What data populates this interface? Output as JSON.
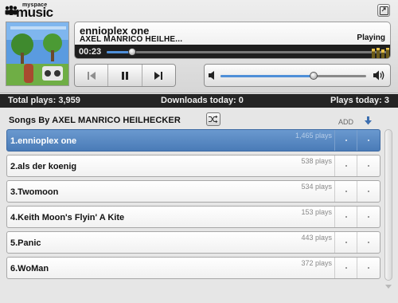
{
  "logo": {
    "small": "myspace",
    "big": "music"
  },
  "now_playing": {
    "title": "ennioplex one",
    "artist": "AXEL MANRICO HEILHE...",
    "status": "Playing",
    "elapsed": "00:23",
    "progress_fraction": 0.09,
    "volume_fraction": 0.64
  },
  "stats": {
    "total_plays": "Total plays: 3,959",
    "downloads_today": "Downloads today: 0",
    "plays_today": "Plays today: 3"
  },
  "songs": {
    "heading": "Songs By AXEL MANRICO HEILHECKER",
    "add_label": "ADD",
    "items": [
      {
        "name": "1.ennioplex one",
        "plays": "1,465 plays"
      },
      {
        "name": "2.als der koenig",
        "plays": "538 plays"
      },
      {
        "name": "3.Twomoon",
        "plays": "534 plays"
      },
      {
        "name": "4.Keith Moon's Flyin' A Kite",
        "plays": "153 plays"
      },
      {
        "name": "5.Panic",
        "plays": "443 plays"
      },
      {
        "name": "6.WoMan",
        "plays": "372 plays"
      }
    ],
    "selected_index": 0
  },
  "colors": {
    "accent": "#4f8fd8",
    "selected_row": "#5585c0",
    "stats_bar": "#242424"
  },
  "icons": [
    "popout-icon",
    "previous-icon",
    "pause-icon",
    "next-icon",
    "volume-low-icon",
    "volume-high-icon",
    "shuffle-icon",
    "download-arrow-icon"
  ]
}
